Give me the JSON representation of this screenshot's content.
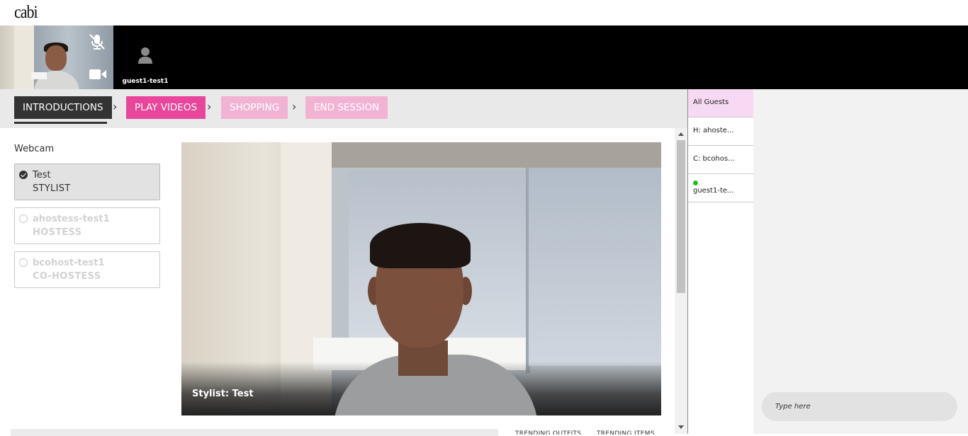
{
  "brand": {
    "logo_text": "cabi"
  },
  "participants": {
    "self": {
      "mic_status": "muted",
      "camera_status": "on"
    },
    "guest": {
      "name": "guest1-test1"
    }
  },
  "steps": [
    {
      "label": "INTRODUCTIONS",
      "state": "active"
    },
    {
      "label": "PLAY VIDEOS",
      "state": "next"
    },
    {
      "label": "SHOPPING",
      "state": "upcoming"
    },
    {
      "label": "END SESSION",
      "state": "upcoming"
    }
  ],
  "webcam": {
    "label": "Webcam",
    "options": [
      {
        "name": "Test",
        "role": "STYLIST",
        "selected": true
      },
      {
        "name": "ahostess-test1",
        "role": "HOSTESS",
        "selected": false
      },
      {
        "name": "bcohost-test1",
        "role": "CO-HOSTESS",
        "selected": false
      }
    ]
  },
  "video": {
    "caption": "Stylist: Test"
  },
  "bottom_tabs": [
    "TRENDING OUTFITS",
    "TRENDING ITEMS"
  ],
  "guests": {
    "items": [
      {
        "label": "All Guests"
      },
      {
        "label": "H: ahoste..."
      },
      {
        "label": "C: bcohos..."
      },
      {
        "label": "guest1-te...",
        "online": true
      }
    ]
  },
  "chat": {
    "placeholder": "Type here"
  },
  "colors": {
    "accent_pink": "#e8459b",
    "pink_light": "#f2b3d3",
    "active_dark": "#333333",
    "guest_highlight": "#f7d9f4",
    "online": "#1ec31e"
  }
}
